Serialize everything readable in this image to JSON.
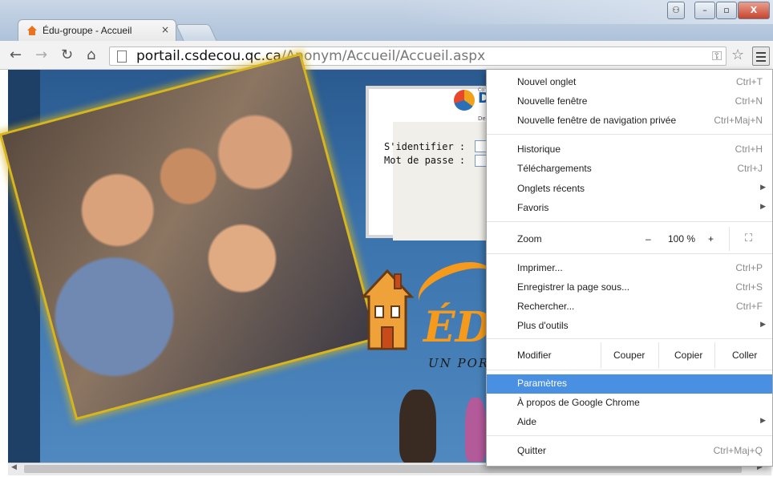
{
  "browser": {
    "tab_title": "Édu-groupe - Accueil",
    "tab_close": "×",
    "url_host": "portail.csdecou.qc.ca",
    "url_path": "/Anonym/Accueil/Accueil.aspx",
    "window_buttons": {
      "user": "⚇",
      "minimize": "–",
      "maximize": "▫",
      "close": "X"
    }
  },
  "page": {
    "login": {
      "username_label": "S'identifier :",
      "password_label": "Mot de passe :"
    },
    "logo_letter": "D",
    "logo_small_top": "Co",
    "logo_small_bottom": "De",
    "brand_text": "ÉD",
    "brand_sub": "UN POR"
  },
  "menu": {
    "items": [
      {
        "label": "Nouvel onglet",
        "shortcut": "Ctrl+T"
      },
      {
        "label": "Nouvelle fenêtre",
        "shortcut": "Ctrl+N"
      },
      {
        "label": "Nouvelle fenêtre de navigation privée",
        "shortcut": "Ctrl+Maj+N"
      },
      {
        "label": "Historique",
        "shortcut": "Ctrl+H"
      },
      {
        "label": "Téléchargements",
        "shortcut": "Ctrl+J"
      },
      {
        "label": "Onglets récents",
        "shortcut": ""
      },
      {
        "label": "Favoris",
        "shortcut": ""
      },
      {
        "label": "Imprimer...",
        "shortcut": "Ctrl+P"
      },
      {
        "label": "Enregistrer la page sous...",
        "shortcut": "Ctrl+S"
      },
      {
        "label": "Rechercher...",
        "shortcut": "Ctrl+F"
      },
      {
        "label": "Plus d'outils",
        "shortcut": ""
      },
      {
        "label": "Paramètres",
        "shortcut": ""
      },
      {
        "label": "À propos de Google Chrome",
        "shortcut": ""
      },
      {
        "label": "Aide",
        "shortcut": ""
      },
      {
        "label": "Quitter",
        "shortcut": "Ctrl+Maj+Q"
      }
    ],
    "zoom": {
      "label": "Zoom",
      "minus": "–",
      "value": "100 %",
      "plus": "+",
      "fullscreen": "⛶"
    },
    "edit": {
      "label": "Modifier",
      "cut": "Couper",
      "copy": "Copier",
      "paste": "Coller"
    },
    "highlight_color": "#4a90e2"
  }
}
